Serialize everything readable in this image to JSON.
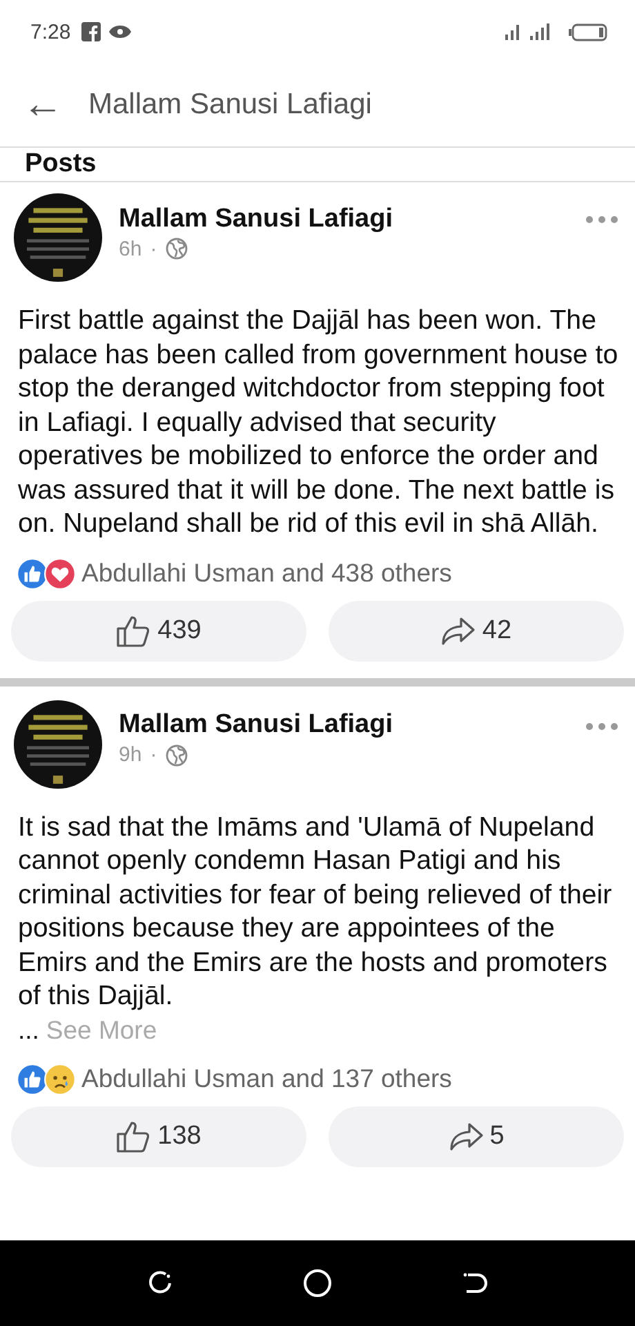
{
  "status_bar": {
    "time": "7:28"
  },
  "header": {
    "back": "←",
    "title": "Mallam Sanusi Lafiagi"
  },
  "section_title": "Posts",
  "posts": [
    {
      "author": "Mallam Sanusi Lafiagi",
      "time": "6h",
      "separator": "·",
      "text": "First battle against the Dajjāl has been won. The palace has been called from government house to stop the deranged witchdoctor from stepping foot in Lafiagi. I equally advised that security operatives be mobilized to enforce the order and was assured that it will be done. The next battle is on. Nupeland shall be rid of this evil in shā Allāh.",
      "reactions": [
        {
          "kind": "like"
        },
        {
          "kind": "love"
        }
      ],
      "reaction_summary": "Abdullahi Usman and 438 others",
      "likes": "439",
      "shares": "42"
    },
    {
      "author": "Mallam Sanusi Lafiagi",
      "time": "9h",
      "separator": "·",
      "text": "It is sad that the Imāms and 'Ulamā of Nupeland cannot openly condemn Hasan Patigi and his criminal activities for fear of being relieved of their positions because they are appointees of the Emirs and the Emirs are the hosts and promoters of this Dajjāl.",
      "ellipsis": "...",
      "see_more": "See More",
      "reactions": [
        {
          "kind": "like"
        },
        {
          "kind": "sad"
        }
      ],
      "reaction_summary": "Abdullahi Usman and 137 others",
      "likes": "138",
      "shares": "5"
    }
  ]
}
